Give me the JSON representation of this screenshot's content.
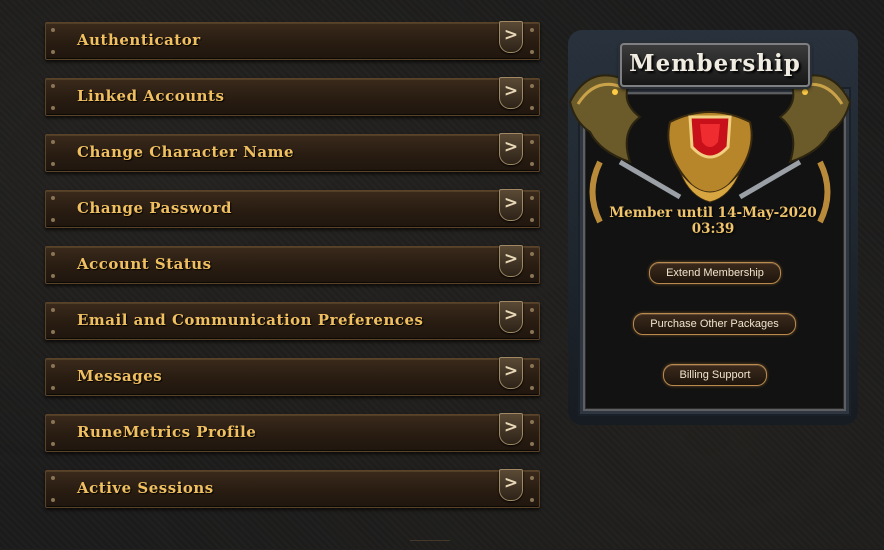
{
  "menu": {
    "items": [
      {
        "label": "Authenticator"
      },
      {
        "label": "Linked Accounts"
      },
      {
        "label": "Change Character Name"
      },
      {
        "label": "Change Password"
      },
      {
        "label": "Account Status"
      },
      {
        "label": "Email and Communication Preferences"
      },
      {
        "label": "Messages"
      },
      {
        "label": "RuneMetrics Profile"
      },
      {
        "label": "Active Sessions"
      }
    ],
    "arrow_glyph": ">"
  },
  "membership": {
    "title": "Membership",
    "member_until": "Member until 14-May-2020 03:39",
    "buttons": {
      "extend": "Extend Membership",
      "packages": "Purchase Other Packages",
      "billing": "Billing Support"
    }
  },
  "icons": [
    "chevron-right-icon",
    "dragon-crest-icon",
    "shield-gem-icon"
  ],
  "colors": {
    "menu_text": "#f0c060",
    "member_text": "#f0c46a",
    "pill_border": "#b98a4d"
  }
}
